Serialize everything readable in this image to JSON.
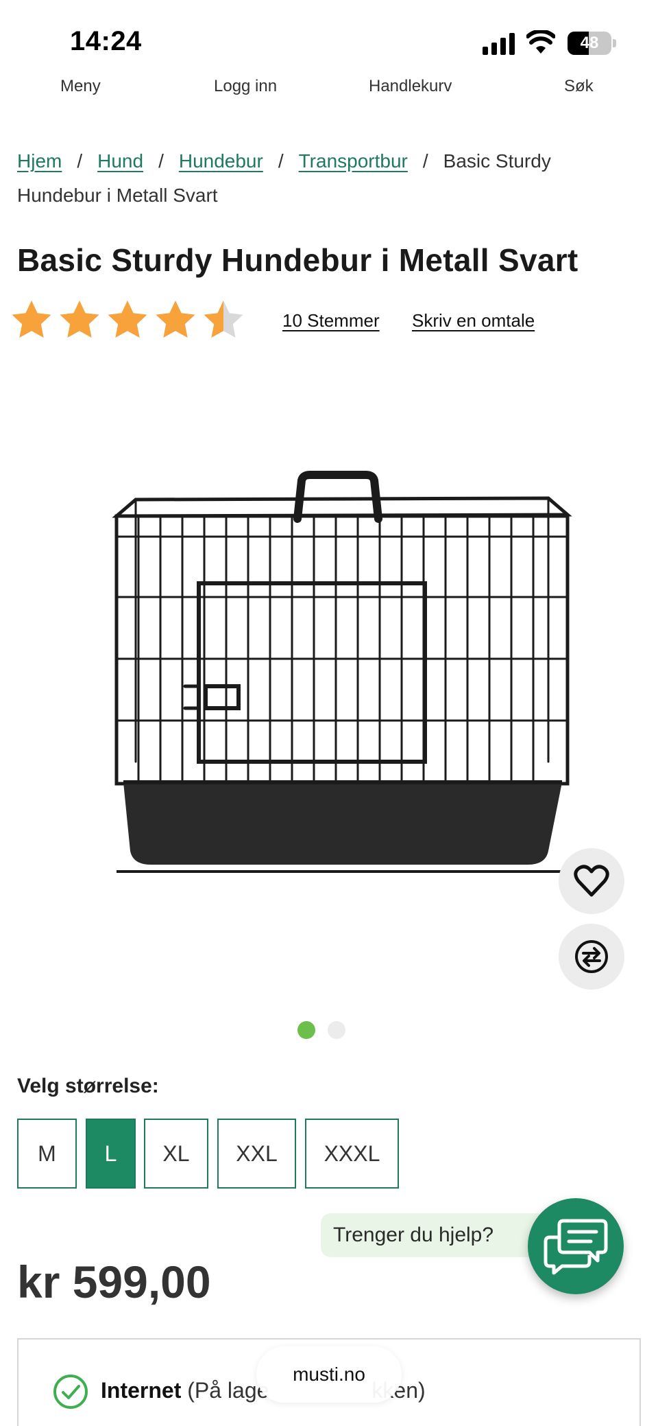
{
  "status_bar": {
    "time": "14:24",
    "battery": "48",
    "battery_level": 0.48
  },
  "nav": {
    "menu": "Meny",
    "login": "Logg inn",
    "cart": "Handlekurv",
    "search": "Søk"
  },
  "breadcrumb": {
    "items": [
      "Hjem",
      "Hund",
      "Hundebur",
      "Transportbur"
    ],
    "separator": "/",
    "current": "Basic Sturdy Hundebur i Metall Svart"
  },
  "product": {
    "title": "Basic Sturdy Hundebur i Metall Svart",
    "rating": 4.5,
    "rating_max": 5,
    "votes_label": "10 Stemmer",
    "review_label": "Skriv en omtale",
    "image_count": 2,
    "active_image": 0,
    "price": "kr 599,00"
  },
  "size": {
    "label": "Velg størrelse:",
    "options": [
      "M",
      "L",
      "XL",
      "XXL",
      "XXXL"
    ],
    "selected": "L"
  },
  "help": {
    "label": "Trenger du hjelp?"
  },
  "availability": {
    "title": "Internet",
    "status_visible": "(På lage",
    "status_tail": "kken)"
  },
  "browser": {
    "url": "musti.no"
  },
  "colors": {
    "brand_green": "#1d8a64",
    "link_green": "#1d7a5f",
    "star": "#f7a23b",
    "star_empty": "#d9d9d9",
    "dot_active": "#6cbf4a"
  }
}
